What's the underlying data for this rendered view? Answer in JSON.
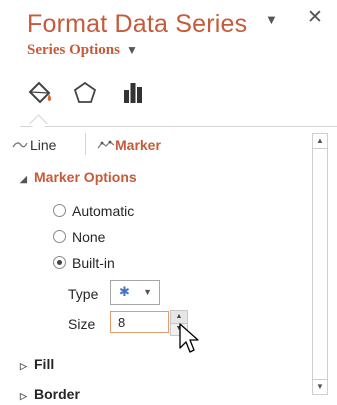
{
  "pane": {
    "title": "Format Data Series",
    "pin_icon": "dropdown-arrow-icon",
    "close_icon": "close-icon",
    "series_options_label": "Series Options",
    "series_options_caret": "▼"
  },
  "category_tabs": [
    {
      "name": "fill-line-icon",
      "selected": true
    },
    {
      "name": "effects-pentagon-icon",
      "selected": false
    },
    {
      "name": "series-options-bar-chart-icon",
      "selected": false
    }
  ],
  "subtabs": {
    "line_label": "Line",
    "marker_label": "Marker",
    "active": "Marker"
  },
  "marker_options": {
    "heading": "Marker Options",
    "radios": {
      "automatic": "Automatic",
      "none": "None",
      "built_in": "Built-in",
      "selected": "Built-in"
    },
    "type_label": "Type",
    "type_value_glyph": "✱",
    "size_label": "Size",
    "size_value": "8"
  },
  "sections": {
    "fill": "Fill",
    "border": "Border"
  },
  "colors": {
    "accent": "#c65a3a",
    "marker_blue": "#4472c4",
    "input_focus_border": "#e59a6e"
  }
}
